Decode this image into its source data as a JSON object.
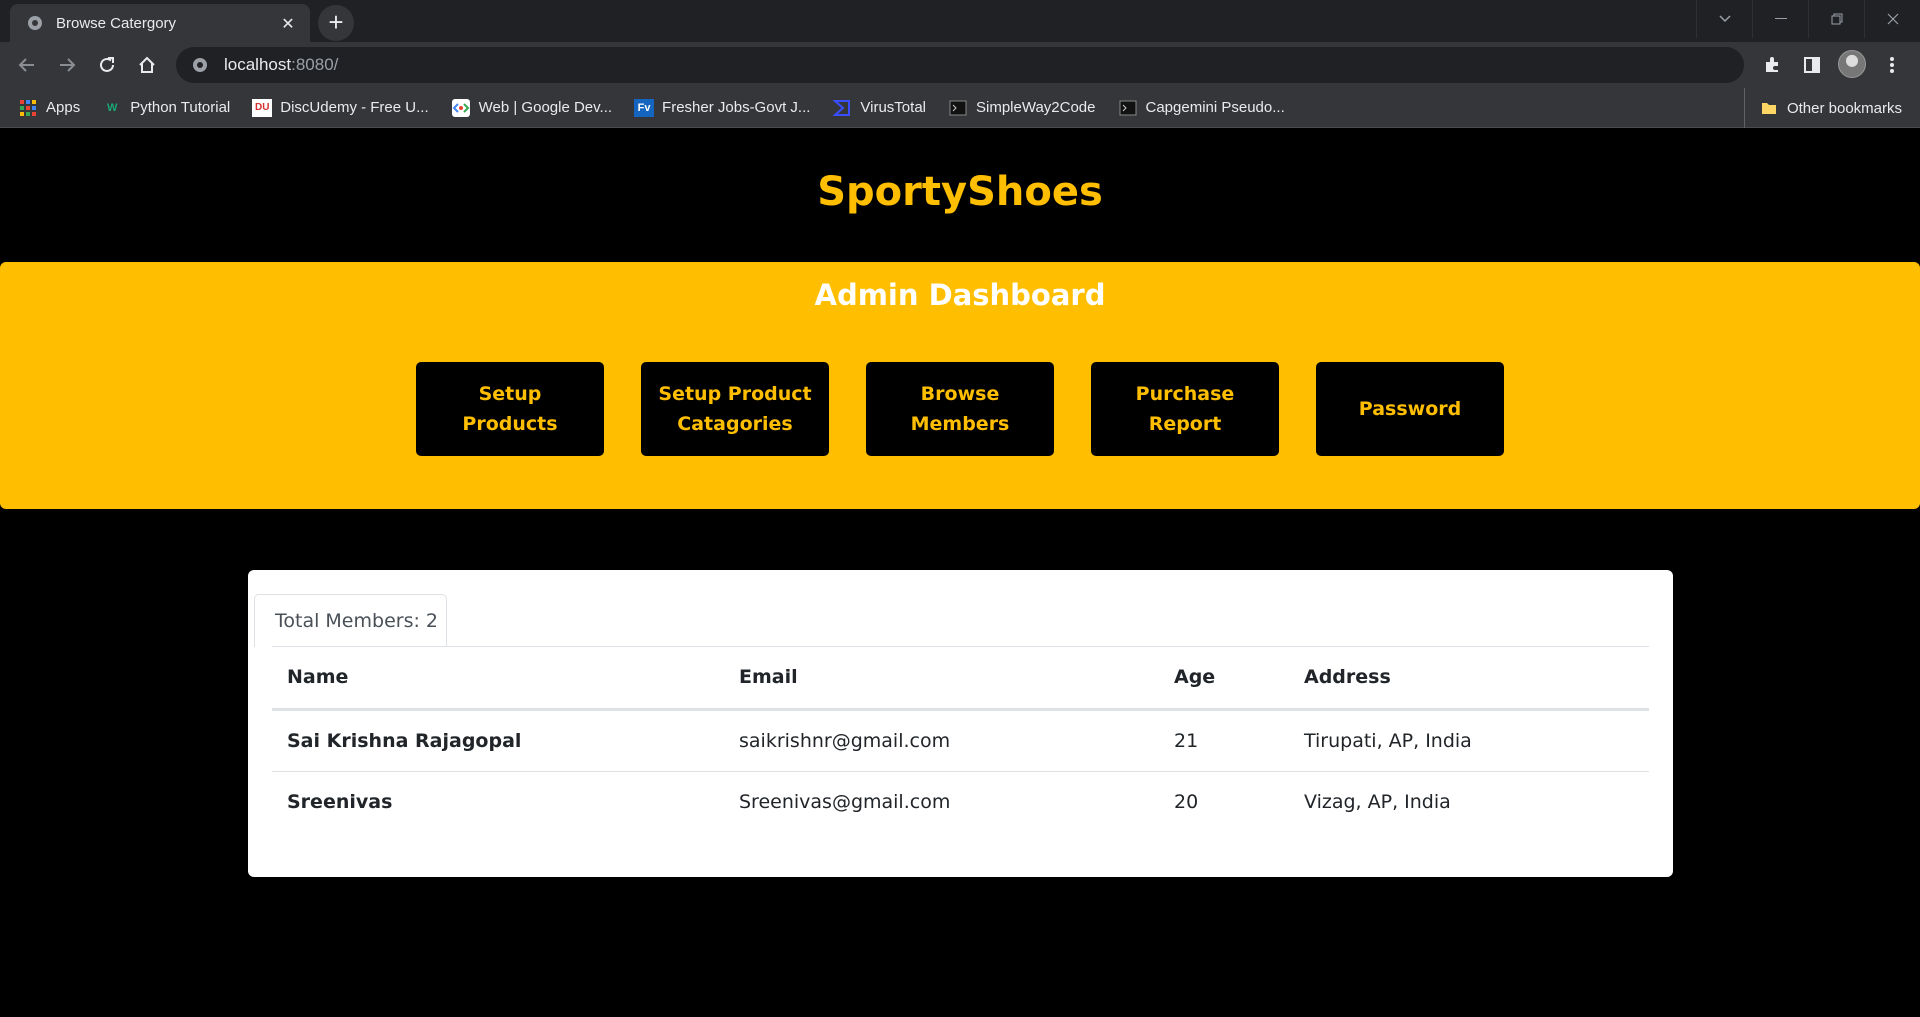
{
  "browser": {
    "tab_title": "Browse Catergory",
    "new_tab_symbol": "+",
    "url_host": "localhost",
    "url_port": ":8080/",
    "bookmarks": [
      {
        "label": "Apps",
        "icon": "apps-grid-icon"
      },
      {
        "label": "Python Tutorial",
        "icon": "w-logo-icon"
      },
      {
        "label": "DiscUdemy - Free U...",
        "icon": "discudemy-icon"
      },
      {
        "label": "Web  |  Google Dev...",
        "icon": "google-dev-icon"
      },
      {
        "label": "Fresher Jobs-Govt J...",
        "icon": "fv-icon"
      },
      {
        "label": "VirusTotal",
        "icon": "virustotal-icon"
      },
      {
        "label": "SimpleWay2Code",
        "icon": "terminal-icon"
      },
      {
        "label": "Capgemini Pseudo...",
        "icon": "terminal-icon"
      }
    ],
    "other_bookmarks": "Other bookmarks"
  },
  "site": {
    "brand": "SportyShoes",
    "accent_color": "#ffbf00"
  },
  "dashboard": {
    "title": "Admin Dashboard",
    "buttons": [
      {
        "label": "Setup Products"
      },
      {
        "label": "Setup Product Catagories"
      },
      {
        "label": "Browse Members"
      },
      {
        "label": "Purchase Report"
      },
      {
        "label": "Password"
      }
    ]
  },
  "members": {
    "tab_label": "Total Members: 2",
    "columns": [
      "Name",
      "Email",
      "Age",
      "Address"
    ],
    "rows": [
      {
        "name": "Sai Krishna Rajagopal",
        "email": "saikrishnr@gmail.com",
        "age": "21",
        "address": "Tirupati, AP, India"
      },
      {
        "name": "Sreenivas",
        "email": "Sreenivas@gmail.com",
        "age": "20",
        "address": "Vizag, AP, India"
      }
    ]
  }
}
